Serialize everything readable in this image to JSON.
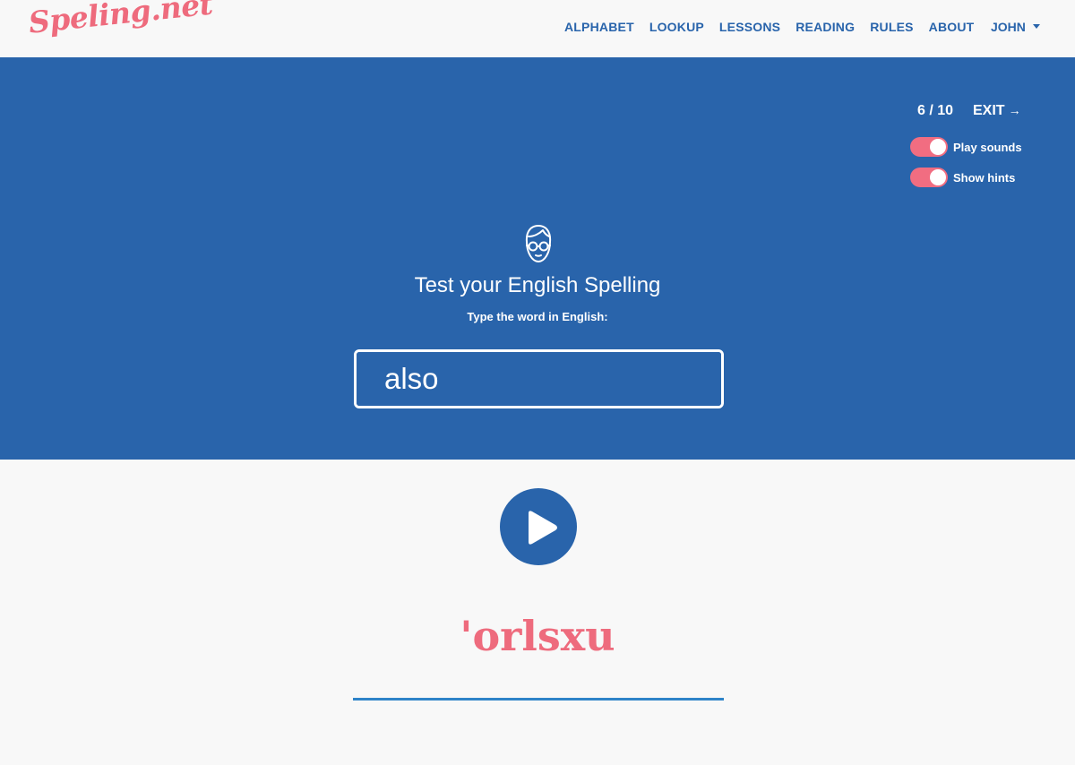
{
  "header": {
    "logo": "Speling.net",
    "nav": [
      "ALPHABET",
      "LOOKUP",
      "LESSONS",
      "READING",
      "RULES",
      "ABOUT"
    ],
    "user": "JOHN"
  },
  "quiz": {
    "progress": "6 / 10",
    "exit_label": "EXIT",
    "toggles": [
      {
        "label": "Play sounds",
        "on": true
      },
      {
        "label": "Show hints",
        "on": true
      }
    ],
    "title": "Test your English Spelling",
    "subtitle": "Type the word in English:",
    "input_value": "also",
    "submit_icon": "arrow-right-icon"
  },
  "hint": {
    "play_icon": "play-icon",
    "phonetic": "'orlsxu"
  },
  "colors": {
    "brand_blue": "#2964ab",
    "accent_pink": "#ee6b7d",
    "toggle_pink": "#f16d81",
    "underline_blue": "#2e83c8",
    "background": "#f8f8f8"
  }
}
